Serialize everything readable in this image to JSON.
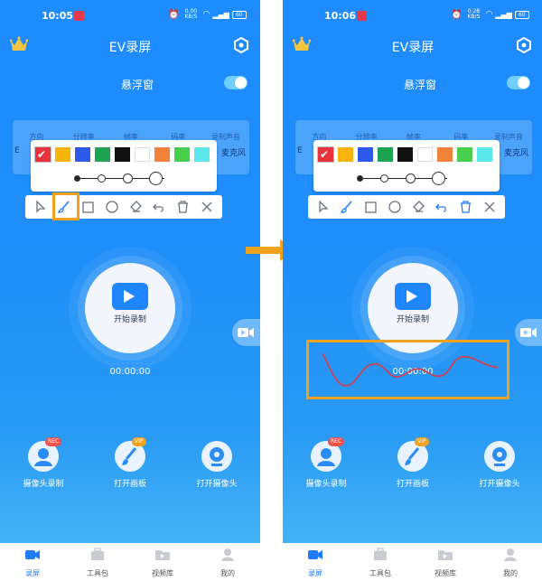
{
  "statusbar_phone1": {
    "time": "10:05",
    "speed": "0.00 KB/S",
    "battery": "60"
  },
  "statusbar_phone2": {
    "time": "10:06",
    "speed": "0.28 KB/S",
    "battery": "60"
  },
  "header": {
    "title": "EV录屏"
  },
  "floating_window": {
    "label": "悬浮窗",
    "enabled": true
  },
  "info": {
    "labels": [
      "方向",
      "分辨率",
      "帧率",
      "码率",
      "录制声音"
    ],
    "values": [
      "",
      "",
      "",
      "",
      "麦克风"
    ],
    "visible_fragments": [
      "E",
      "E"
    ]
  },
  "palette": {
    "colors": [
      "#e8333c",
      "#f8b40c",
      "#2d5ae8",
      "#1ea352",
      "#111111",
      "#ffffff",
      "#f0823a",
      "#48d04c",
      "#5ae8ea"
    ],
    "selected_index": 0,
    "selected_size_index": 0
  },
  "toolbar": {
    "tools": [
      "select-arrow-icon",
      "brush-icon",
      "rectangle-icon",
      "circle-icon",
      "eraser-icon",
      "undo-icon",
      "trash-icon",
      "close-icon"
    ],
    "phone1_active": "brush-icon",
    "phone2_active": [
      "brush-icon",
      "undo-icon",
      "trash-icon"
    ]
  },
  "record": {
    "label": "开始录制",
    "timer": "00:00:00"
  },
  "features": [
    {
      "label": "摄像头录制",
      "badge": "REC",
      "icon": "camera-user-icon"
    },
    {
      "label": "打开画板",
      "badge": "VIP",
      "icon": "paintbrush-icon"
    },
    {
      "label": "打开摄像头",
      "badge": "",
      "icon": "webcam-icon"
    }
  ],
  "nav": [
    {
      "label": "录屏",
      "active": true
    },
    {
      "label": "工具包",
      "active": false
    },
    {
      "label": "视频库",
      "active": false
    },
    {
      "label": "我的",
      "active": false
    }
  ],
  "colors": {
    "highlight": "#f0a21f",
    "accent": "#1e7cff",
    "ink": "#e8333c"
  }
}
